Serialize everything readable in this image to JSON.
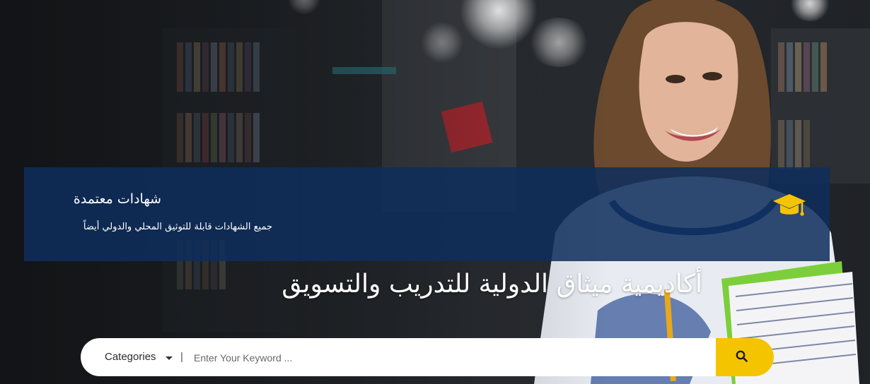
{
  "feature": {
    "title": "شهادات معتمدة",
    "description": "جميع الشهادات قابلة للتوثيق المحلي والدولي أيضاً",
    "icon": "graduation-cap-icon",
    "accent_color": "#f5c400"
  },
  "hero": {
    "headline": "أكاديمية ميثاق الدولية للتدريب والتسويق"
  },
  "search": {
    "category_label": "Categories",
    "separator": "|",
    "placeholder": "Enter Your Keyword ...",
    "value": "",
    "button_icon": "search-icon",
    "button_color": "#f5c400"
  },
  "colors": {
    "banner_bg": "#0e2d5c",
    "text": "#ffffff"
  }
}
